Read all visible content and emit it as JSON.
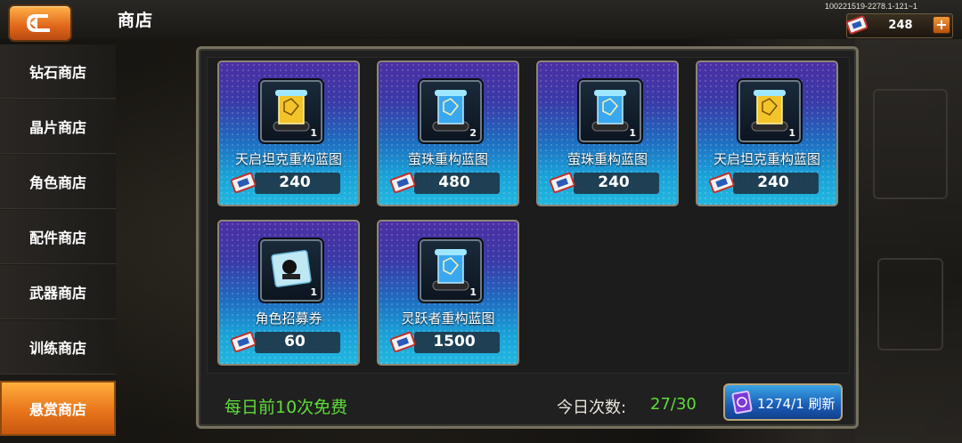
{
  "header": {
    "title": "商店",
    "version": "100221519-2278.1-121~1",
    "currency_value": "248",
    "currency_plus": "+"
  },
  "sidebar": {
    "items": [
      {
        "label": "钻石商店"
      },
      {
        "label": "晶片商店"
      },
      {
        "label": "角色商店"
      },
      {
        "label": "配件商店"
      },
      {
        "label": "武器商店"
      },
      {
        "label": "训练商店"
      },
      {
        "label": "悬赏商店"
      }
    ],
    "active": "悬赏商店"
  },
  "shop": {
    "items": [
      {
        "name": "天启坦克重构蓝图",
        "qty": "1",
        "price": "240",
        "icon": "gold-scroll-icon"
      },
      {
        "name": "萤珠重构蓝图",
        "qty": "2",
        "price": "480",
        "icon": "blue-scroll-icon"
      },
      {
        "name": "萤珠重构蓝图",
        "qty": "1",
        "price": "240",
        "icon": "blue-scroll-icon"
      },
      {
        "name": "天启坦克重构蓝图",
        "qty": "1",
        "price": "240",
        "icon": "gold-scroll-icon"
      },
      {
        "name": "角色招募券",
        "qty": "1",
        "price": "60",
        "icon": "recruit-ticket-icon"
      },
      {
        "name": "灵跃者重构蓝图",
        "qty": "1",
        "price": "1500",
        "icon": "blue-scroll-icon"
      }
    ]
  },
  "footer": {
    "free_text": "每日前10次免费",
    "count_label": "今日次数:",
    "count_value": "27/30",
    "refresh_label": "1274/1 刷新"
  },
  "colors": {
    "accent_orange": "#e8751c",
    "free_green": "#5fdc3a",
    "card_purple": "#4b2fa3",
    "card_blue": "#22b7e0"
  }
}
